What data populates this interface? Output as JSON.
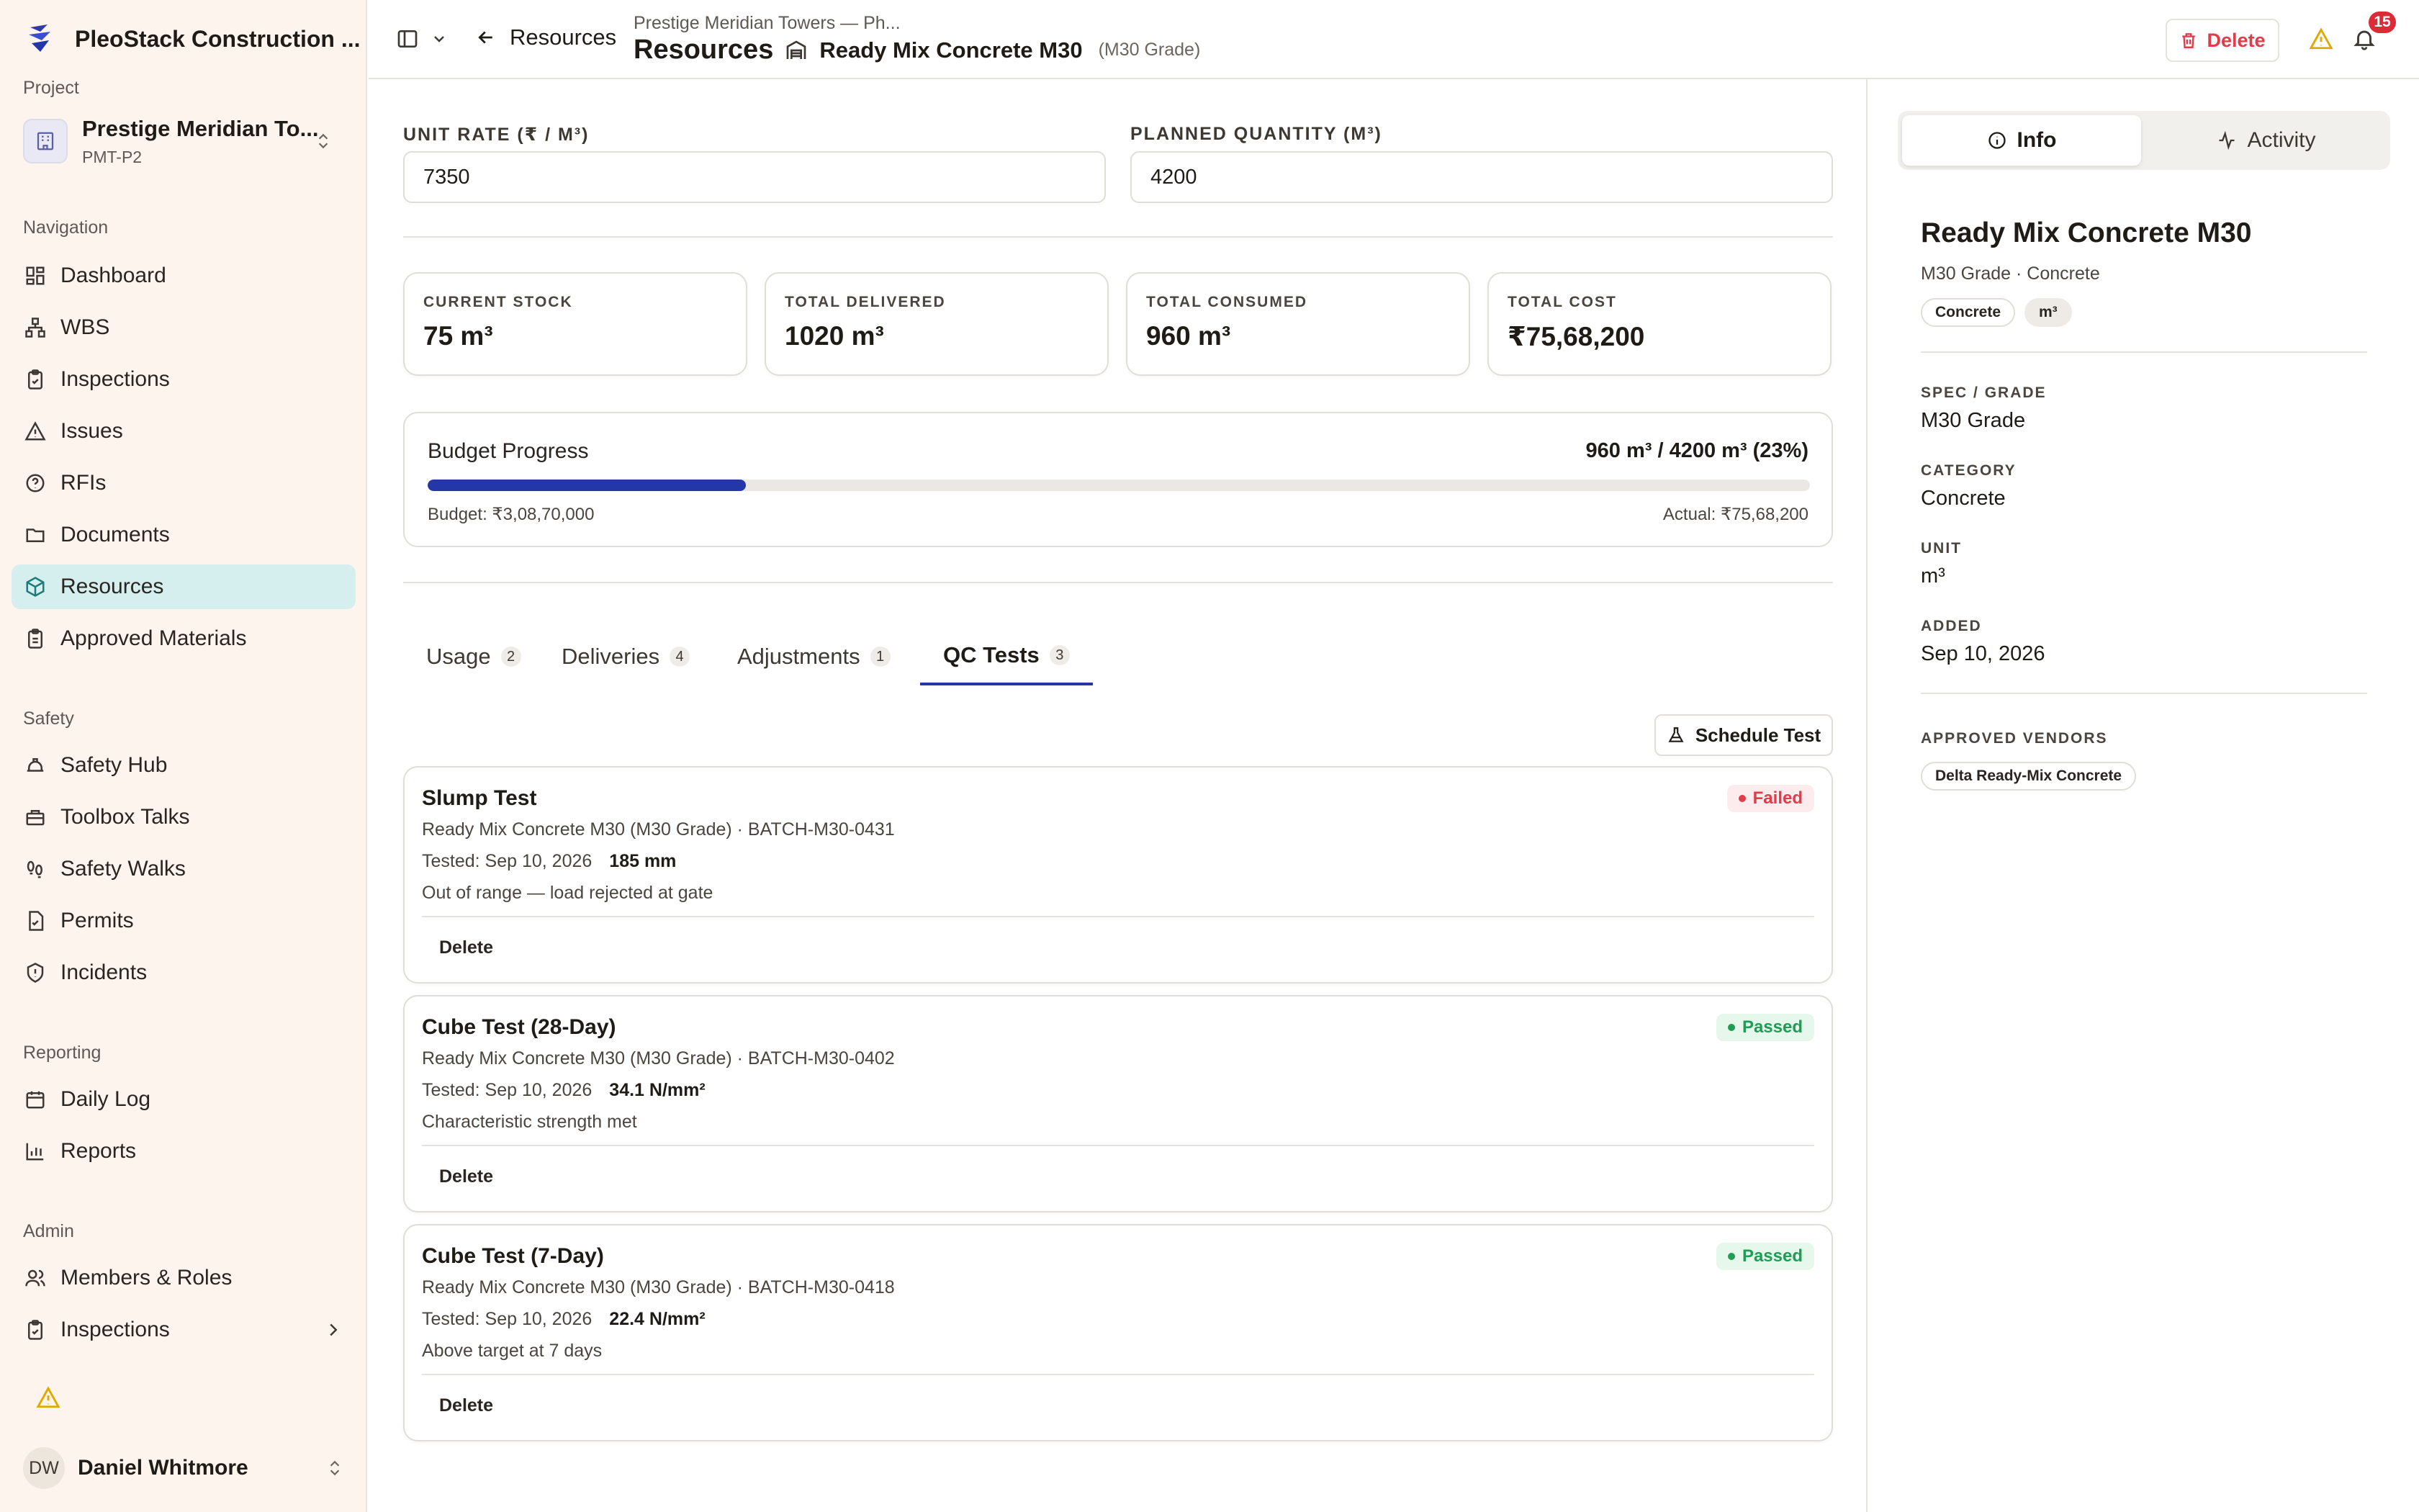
{
  "app": {
    "name": "PleoStack Construction ..."
  },
  "sidebar": {
    "project_label": "Project",
    "project": {
      "name": "Prestige Meridian To...",
      "code": "PMT-P2"
    },
    "sections": {
      "navigation": "Navigation",
      "safety": "Safety",
      "reporting": "Reporting",
      "admin": "Admin"
    },
    "nav": [
      {
        "label": "Dashboard"
      },
      {
        "label": "WBS"
      },
      {
        "label": "Inspections"
      },
      {
        "label": "Issues"
      },
      {
        "label": "RFIs"
      },
      {
        "label": "Documents"
      },
      {
        "label": "Resources"
      },
      {
        "label": "Approved Materials"
      }
    ],
    "safety": [
      {
        "label": "Safety Hub"
      },
      {
        "label": "Toolbox Talks"
      },
      {
        "label": "Safety Walks"
      },
      {
        "label": "Permits"
      },
      {
        "label": "Incidents"
      }
    ],
    "reporting": [
      {
        "label": "Daily Log"
      },
      {
        "label": "Reports"
      }
    ],
    "admin": [
      {
        "label": "Members & Roles"
      },
      {
        "label": "Inspections"
      }
    ],
    "user": {
      "initials": "DW",
      "name": "Daniel Whitmore"
    }
  },
  "header": {
    "back_label": "Resources",
    "breadcrumb": "Prestige Meridian Towers — Ph...",
    "page_title": "Resources",
    "resource_name": "Ready Mix Concrete M30",
    "resource_grade": "(M30 Grade)",
    "delete_label": "Delete",
    "notification_count": "15"
  },
  "form": {
    "unit_rate_label": "UNIT RATE (₹ / M³)",
    "unit_rate_value": "7350",
    "planned_qty_label": "PLANNED QUANTITY (M³)",
    "planned_qty_value": "4200"
  },
  "stats": [
    {
      "label": "CURRENT STOCK",
      "value": "75 m³"
    },
    {
      "label": "TOTAL DELIVERED",
      "value": "1020 m³"
    },
    {
      "label": "TOTAL CONSUMED",
      "value": "960 m³"
    },
    {
      "label": "TOTAL COST",
      "value": "₹75,68,200"
    }
  ],
  "budget": {
    "title": "Budget Progress",
    "ratio": "960 m³ / 4200 m³ (23%)",
    "progress_percent": 23,
    "budget_text": "Budget: ₹3,08,70,000",
    "actual_text": "Actual: ₹75,68,200"
  },
  "tabs": [
    {
      "label": "Usage",
      "count": "2"
    },
    {
      "label": "Deliveries",
      "count": "4"
    },
    {
      "label": "Adjustments",
      "count": "1"
    },
    {
      "label": "QC Tests",
      "count": "3",
      "active": true
    }
  ],
  "schedule_label": "Schedule Test",
  "qc_tests": [
    {
      "name": "Slump Test",
      "subtitle": "Ready Mix Concrete M30 (M30 Grade) · BATCH-M30-0431",
      "tested": "Tested: Sep 10, 2026",
      "result": "185 mm",
      "note": "Out of range — load rejected at gate",
      "status": "Failed",
      "delete_label": "Delete"
    },
    {
      "name": "Cube Test (28-Day)",
      "subtitle": "Ready Mix Concrete M30 (M30 Grade) · BATCH-M30-0402",
      "tested": "Tested: Sep 10, 2026",
      "result": "34.1 N/mm²",
      "note": "Characteristic strength met",
      "status": "Passed",
      "delete_label": "Delete"
    },
    {
      "name": "Cube Test (7-Day)",
      "subtitle": "Ready Mix Concrete M30 (M30 Grade) · BATCH-M30-0418",
      "tested": "Tested: Sep 10, 2026",
      "result": "22.4 N/mm²",
      "note": "Above target at 7 days",
      "status": "Passed",
      "delete_label": "Delete"
    }
  ],
  "panel": {
    "tab_info": "Info",
    "tab_activity": "Activity",
    "title": "Ready Mix Concrete M30",
    "subtitle": "M30 Grade · Concrete",
    "chips": [
      "Concrete",
      "m³"
    ],
    "spec_label": "SPEC / GRADE",
    "spec_value": "M30 Grade",
    "category_label": "CATEGORY",
    "category_value": "Concrete",
    "unit_label": "UNIT",
    "unit_value": "m³",
    "added_label": "ADDED",
    "added_value": "Sep 10, 2026",
    "vendors_label": "APPROVED VENDORS",
    "vendors": [
      "Delta Ready-Mix Concrete"
    ]
  },
  "colors": {
    "accent": "#2437a8",
    "sidebar_bg": "#fdf5ed",
    "active_nav": "#d5eeee",
    "danger": "#e23b4a",
    "success": "#1f9d55",
    "warning": "#e0a800"
  },
  "icons": {
    "brand": "stack-logo-icon",
    "warning": "warning-triangle-icon",
    "bell": "bell-icon",
    "trash": "trash-icon",
    "flask": "flask-icon"
  }
}
